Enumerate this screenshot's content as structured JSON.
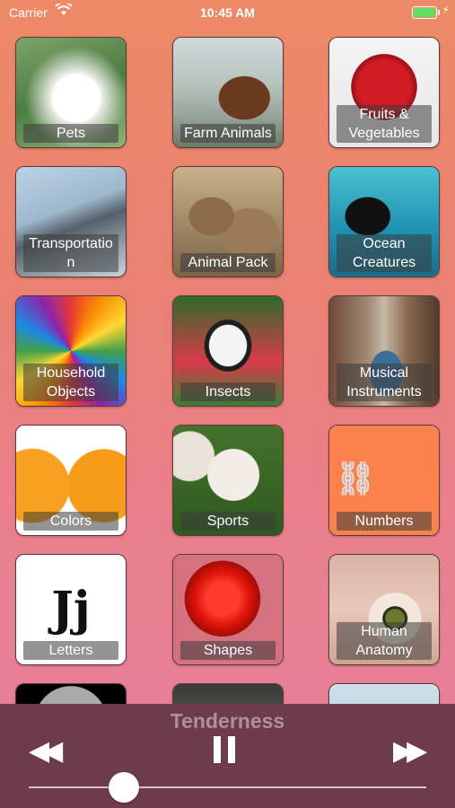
{
  "status_bar": {
    "carrier": "Carrier",
    "time": "10:45 AM",
    "battery_level": 1.0
  },
  "categories": [
    {
      "label": "Pets",
      "image": "white-dog-photo"
    },
    {
      "label": "Farm Animals",
      "image": "horse-photo"
    },
    {
      "label": "Fruits &\nVegetables",
      "image": "red-apple-photo"
    },
    {
      "label": "Transportatio\nn",
      "image": "fighter-jet-photo"
    },
    {
      "label": "Animal Pack",
      "image": "meerkats-photo"
    },
    {
      "label": "Ocean\nCreatures",
      "image": "orca-photo"
    },
    {
      "label": "Household\nObjects",
      "image": "colored-pencils-photo"
    },
    {
      "label": "Insects",
      "image": "butterfly-photo"
    },
    {
      "label": "Musical\nInstruments",
      "image": "guitar-photo"
    },
    {
      "label": "Colors",
      "image": "oranges-photo"
    },
    {
      "label": "Sports",
      "image": "baseballs-photo"
    },
    {
      "label": "Numbers",
      "image": "number-one-icon"
    },
    {
      "label": "Letters",
      "image": "letters-jj-icon",
      "glyph": "Jj"
    },
    {
      "label": "Shapes",
      "image": "red-sphere-icon"
    },
    {
      "label": "Human\nAnatomy",
      "image": "eye-photo"
    },
    {
      "label": "",
      "image": "moon-photo"
    },
    {
      "label": "",
      "image": "plant-photo"
    },
    {
      "label": "",
      "image": "snow-photo"
    }
  ],
  "player": {
    "track_title": "Tenderness",
    "rewind_icon": "rewind-icon",
    "pause_icon": "pause-icon",
    "forward_icon": "fast-forward-icon",
    "progress": 0.24
  }
}
